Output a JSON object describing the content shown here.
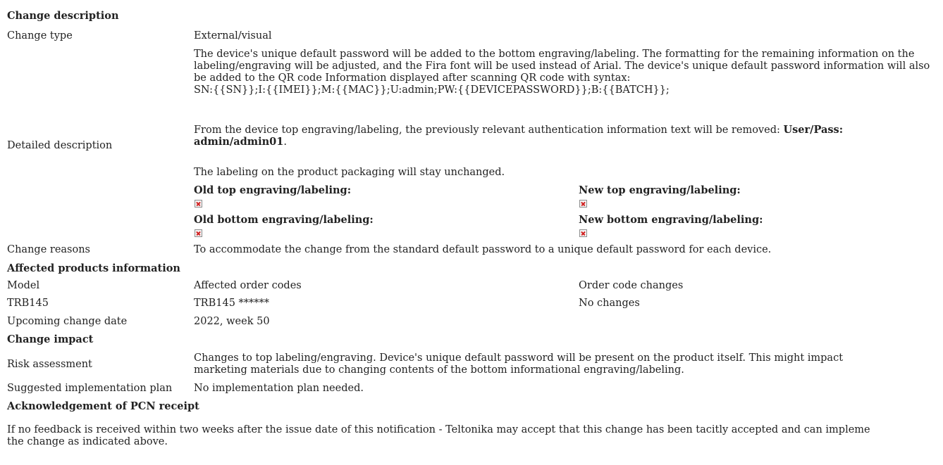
{
  "change_description": {
    "heading": "Change description",
    "change_type_label": "Change type",
    "change_type_value": "External/visual",
    "detailed_label": "Detailed description",
    "para1": "The device's unique default password will be added to the bottom engraving/labeling. The formatting for the remaining information on the labeling/engraving will be adjusted, and the Fira font will be used instead of Arial. The device's unique default password information will also be added to the QR code Information displayed after scanning QR code with syntax:",
    "syntax": "SN:{{SN}};I:{{IMEI}};M:{{MAC}};U:admin;PW:{{DEVICEPASSWORD}};B:{{BATCH}};",
    "para2_text": "From the device top engraving/labeling, the previously relevant authentication information text will be removed: ",
    "para2_bold_1": "User/Pass:",
    "para2_bold_2": "admin/admin01",
    "para2_end": ".",
    "para3": "The labeling on the product packaging will stay unchanged.",
    "old_top": "Old top engraving/labeling:",
    "new_top": "New top engraving/labeling:",
    "old_bottom": "Old bottom engraving/labeling:",
    "new_bottom": "New bottom engraving/labeling:",
    "image_icon": "broken-image-icon",
    "reasons_label": "Change reasons",
    "reasons_value": "To accommodate the change from the standard default password to a unique default password for each device."
  },
  "affected": {
    "heading": "Affected products information",
    "headers": [
      "Model",
      "Affected order codes",
      "Order code changes"
    ],
    "row": [
      "TRB145",
      "TRB145 ******",
      "No changes"
    ],
    "date_label": "Upcoming change date",
    "date_value": "2022, week 50"
  },
  "impact": {
    "heading": "Change impact",
    "risk_label": "Risk assessment",
    "risk_line1": "Changes to top labeling/engraving. Device's unique default password will be present on the product itself. This might impact",
    "risk_line2": "marketing materials due to changing contents of the bottom informational engraving/labeling.",
    "plan_label": "Suggested implementation plan",
    "plan_value": "No implementation plan needed."
  },
  "ack": {
    "heading": "Acknowledgement of PCN receipt",
    "line1": "If no feedback is received within two weeks after the issue date of this notification - Teltonika may accept that this change has been tacitly accepted and can impleme",
    "line2": "the change as indicated above."
  }
}
